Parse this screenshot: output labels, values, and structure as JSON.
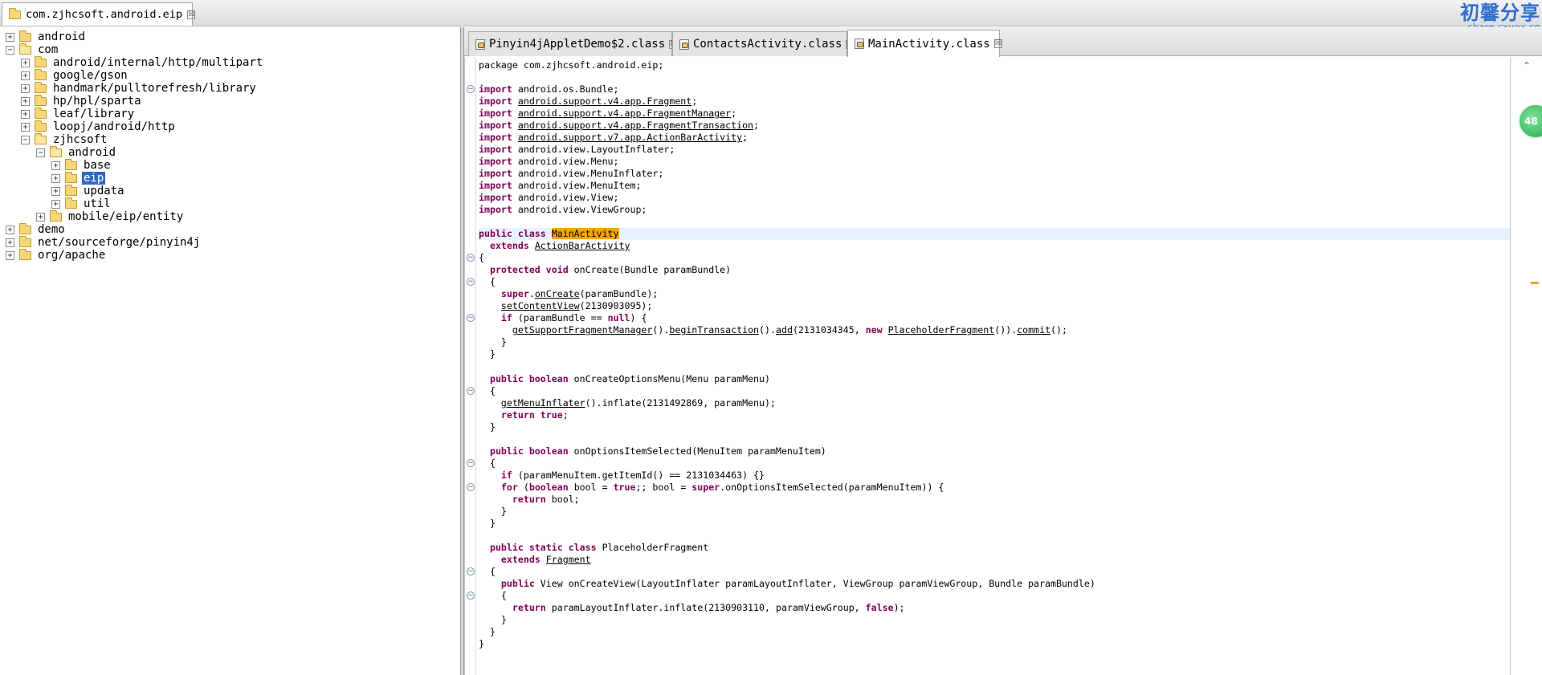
{
  "root_tab": {
    "label": "com.zjhcsoft.android.eip",
    "icon": "folder-icon",
    "close": "☒"
  },
  "watermark": {
    "title": "初馨分享",
    "url": "share.cxyqx.cn"
  },
  "tree": [
    {
      "label": "android",
      "expanded": false,
      "selected": false
    },
    {
      "label": "com",
      "expanded": true,
      "selected": false
    },
    {
      "label": "android/internal/http/multipart",
      "expanded": false,
      "selected": false
    },
    {
      "label": "google/gson",
      "expanded": false,
      "selected": false
    },
    {
      "label": "handmark/pulltorefresh/library",
      "expanded": false,
      "selected": false
    },
    {
      "label": "hp/hpl/sparta",
      "expanded": false,
      "selected": false
    },
    {
      "label": "leaf/library",
      "expanded": false,
      "selected": false
    },
    {
      "label": "loopj/android/http",
      "expanded": false,
      "selected": false
    },
    {
      "label": "zjhcsoft",
      "expanded": true,
      "selected": false
    },
    {
      "label": "android",
      "expanded": true,
      "selected": false
    },
    {
      "label": "base",
      "expanded": false,
      "selected": false
    },
    {
      "label": "eip",
      "expanded": false,
      "selected": true
    },
    {
      "label": "updata",
      "expanded": false,
      "selected": false
    },
    {
      "label": "util",
      "expanded": false,
      "selected": false
    },
    {
      "label": "mobile/eip/entity",
      "expanded": false,
      "selected": false
    },
    {
      "label": "demo",
      "expanded": false,
      "selected": false
    },
    {
      "label": "net/sourceforge/pinyin4j",
      "expanded": false,
      "selected": false
    },
    {
      "label": "org/apache",
      "expanded": false,
      "selected": false
    }
  ],
  "editor_tabs": [
    {
      "label": "Pinyin4jAppletDemo$2.class",
      "active": false
    },
    {
      "label": "ContactsActivity.class",
      "active": false
    },
    {
      "label": "MainActivity.class",
      "active": true
    }
  ],
  "code": [
    [
      [
        "package com.zjhcsoft.android.eip;",
        ""
      ]
    ],
    [],
    [
      [
        "import",
        "kw"
      ],
      [
        " android.os.Bundle;",
        ""
      ]
    ],
    [
      [
        "import",
        "kw"
      ],
      [
        " ",
        ""
      ],
      [
        "android.support.v4.app.Fragment",
        "u"
      ],
      [
        ";",
        ""
      ]
    ],
    [
      [
        "import",
        "kw"
      ],
      [
        " ",
        ""
      ],
      [
        "android.support.v4.app.FragmentManager",
        "u"
      ],
      [
        ";",
        ""
      ]
    ],
    [
      [
        "import",
        "kw"
      ],
      [
        " ",
        ""
      ],
      [
        "android.support.v4.app.FragmentTransaction",
        "u"
      ],
      [
        ";",
        ""
      ]
    ],
    [
      [
        "import",
        "kw"
      ],
      [
        " ",
        ""
      ],
      [
        "android.support.v7.app.ActionBarActivity",
        "u"
      ],
      [
        ";",
        ""
      ]
    ],
    [
      [
        "import",
        "kw"
      ],
      [
        " android.view.LayoutInflater;",
        ""
      ]
    ],
    [
      [
        "import",
        "kw"
      ],
      [
        " android.view.Menu;",
        ""
      ]
    ],
    [
      [
        "import",
        "kw"
      ],
      [
        " android.view.MenuInflater;",
        ""
      ]
    ],
    [
      [
        "import",
        "kw"
      ],
      [
        " android.view.MenuItem;",
        ""
      ]
    ],
    [
      [
        "import",
        "kw"
      ],
      [
        " android.view.View;",
        ""
      ]
    ],
    [
      [
        "import",
        "kw"
      ],
      [
        " android.view.ViewGroup;",
        ""
      ]
    ],
    [],
    [
      [
        "public class",
        "kw"
      ],
      [
        " ",
        ""
      ],
      [
        "MainActivity",
        "mark"
      ]
    ],
    [
      [
        "  extends",
        "kw"
      ],
      [
        " ",
        ""
      ],
      [
        "ActionBarActivity",
        "u"
      ]
    ],
    [
      [
        "{",
        ""
      ]
    ],
    [
      [
        "  ",
        ""
      ],
      [
        "protected void",
        "kw"
      ],
      [
        " onCreate(Bundle paramBundle)",
        ""
      ]
    ],
    [
      [
        "  {",
        ""
      ]
    ],
    [
      [
        "    ",
        ""
      ],
      [
        "super",
        "kw"
      ],
      [
        ".",
        ""
      ],
      [
        "onCreate",
        "u"
      ],
      [
        "(paramBundle);",
        ""
      ]
    ],
    [
      [
        "    ",
        ""
      ],
      [
        "setContentView",
        "u"
      ],
      [
        "(2130903095);",
        ""
      ]
    ],
    [
      [
        "    ",
        ""
      ],
      [
        "if",
        "kw"
      ],
      [
        " (paramBundle == ",
        ""
      ],
      [
        "null",
        "kw"
      ],
      [
        ") {",
        ""
      ]
    ],
    [
      [
        "      ",
        ""
      ],
      [
        "getSupportFragmentManager",
        "u"
      ],
      [
        "().",
        ""
      ],
      [
        "beginTransaction",
        "u"
      ],
      [
        "().",
        ""
      ],
      [
        "add",
        "u"
      ],
      [
        "(2131034345, ",
        ""
      ],
      [
        "new",
        "kw"
      ],
      [
        " ",
        ""
      ],
      [
        "PlaceholderFragment",
        "u"
      ],
      [
        "()).",
        ""
      ],
      [
        "commit",
        "u"
      ],
      [
        "();",
        ""
      ]
    ],
    [
      [
        "    }",
        ""
      ]
    ],
    [
      [
        "  }",
        ""
      ]
    ],
    [],
    [
      [
        "  ",
        ""
      ],
      [
        "public boolean",
        "kw"
      ],
      [
        " onCreateOptionsMenu(Menu paramMenu)",
        ""
      ]
    ],
    [
      [
        "  {",
        ""
      ]
    ],
    [
      [
        "    ",
        ""
      ],
      [
        "getMenuInflater",
        "u"
      ],
      [
        "().inflate(2131492869, paramMenu);",
        ""
      ]
    ],
    [
      [
        "    ",
        ""
      ],
      [
        "return true",
        "kw"
      ],
      [
        ";",
        ""
      ]
    ],
    [
      [
        "  }",
        ""
      ]
    ],
    [],
    [
      [
        "  ",
        ""
      ],
      [
        "public boolean",
        "kw"
      ],
      [
        " onOptionsItemSelected(MenuItem paramMenuItem)",
        ""
      ]
    ],
    [
      [
        "  {",
        ""
      ]
    ],
    [
      [
        "    ",
        ""
      ],
      [
        "if",
        "kw"
      ],
      [
        " (paramMenuItem.getItemId() == 2131034463) {}",
        ""
      ]
    ],
    [
      [
        "    ",
        ""
      ],
      [
        "for",
        "kw"
      ],
      [
        " (",
        ""
      ],
      [
        "boolean",
        "kw"
      ],
      [
        " bool = ",
        ""
      ],
      [
        "true",
        "kw"
      ],
      [
        ";; bool = ",
        ""
      ],
      [
        "super",
        "kw"
      ],
      [
        ".onOptionsItemSelected(paramMenuItem)) {",
        ""
      ]
    ],
    [
      [
        "      ",
        ""
      ],
      [
        "return",
        "kw"
      ],
      [
        " bool;",
        ""
      ]
    ],
    [
      [
        "    }",
        ""
      ]
    ],
    [
      [
        "  }",
        ""
      ]
    ],
    [],
    [
      [
        "  ",
        ""
      ],
      [
        "public static class",
        "kw"
      ],
      [
        " PlaceholderFragment",
        ""
      ]
    ],
    [
      [
        "    ",
        ""
      ],
      [
        "extends",
        "kw"
      ],
      [
        " ",
        ""
      ],
      [
        "Fragment",
        "u"
      ]
    ],
    [
      [
        "  {",
        ""
      ]
    ],
    [
      [
        "    ",
        ""
      ],
      [
        "public",
        "kw"
      ],
      [
        " View onCreateView(LayoutInflater paramLayoutInflater, ViewGroup paramViewGroup, Bundle paramBundle)",
        ""
      ]
    ],
    [
      [
        "    {",
        ""
      ]
    ],
    [
      [
        "      ",
        ""
      ],
      [
        "return",
        "kw"
      ],
      [
        " paramLayoutInflater.inflate(2130903110, paramViewGroup, ",
        ""
      ],
      [
        "false",
        "kw"
      ],
      [
        ");",
        ""
      ]
    ],
    [
      [
        "    }",
        ""
      ]
    ],
    [
      [
        "  }",
        ""
      ]
    ],
    [
      [
        "}",
        ""
      ]
    ]
  ],
  "badge": {
    "text": "48"
  },
  "colors": {
    "keyword": "#7f0055",
    "selection": "#316ac5",
    "highlight": "#e8f2fe",
    "match": "#f7a600",
    "watermark": "#2f6fd0"
  }
}
